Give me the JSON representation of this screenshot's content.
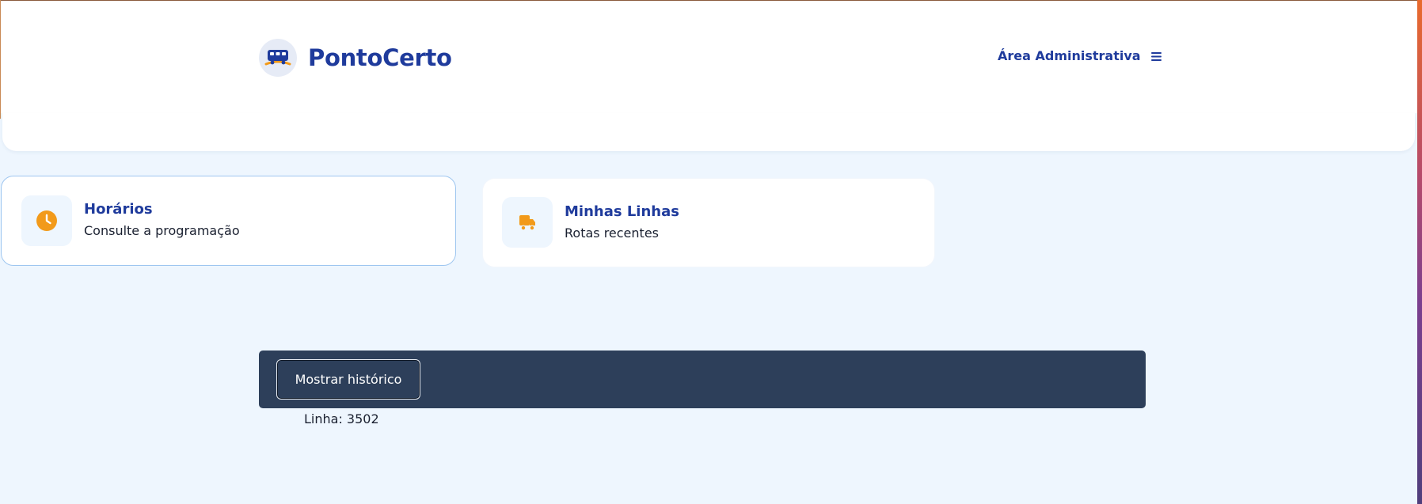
{
  "header": {
    "brand_name": "PontoCerto",
    "admin_link_label": "Área Administrativa"
  },
  "cards": [
    {
      "title": "Horários",
      "subtitle": "Consulte a programação",
      "icon": "clock-icon"
    },
    {
      "title": "Minhas Linhas",
      "subtitle": "Rotas recentes",
      "icon": "truck-icon"
    }
  ],
  "history": {
    "button_label": "Mostrar histórico",
    "linha_text": "Linha: 3502"
  },
  "colors": {
    "brand_blue": "#1f3b9c",
    "accent_orange": "#f29a1a",
    "page_background": "#eef6fe",
    "dark_bar": "#2d3f5a"
  }
}
